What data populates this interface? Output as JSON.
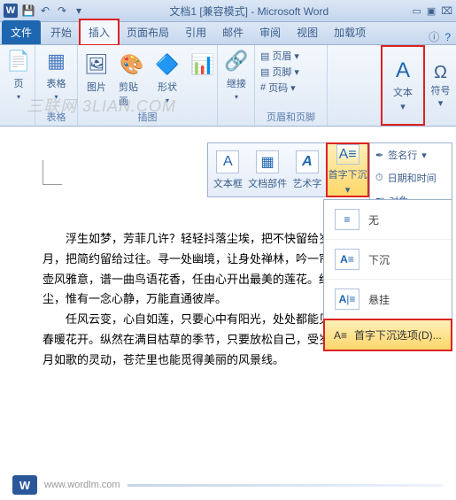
{
  "title": "文档1 [兼容模式] - Microsoft Word",
  "tabs": {
    "file": "文件",
    "home": "开始",
    "insert": "插入",
    "layout": "页面布局",
    "ref": "引用",
    "mail": "邮件",
    "review": "审阅",
    "view": "视图",
    "addin": "加载项"
  },
  "ribbon": {
    "page": "页",
    "table": "表格",
    "pic": "图片",
    "clip": "剪贴画",
    "shape": "形状",
    "chart": "继接",
    "glabels": {
      "table": "表格",
      "illus": "插图",
      "hdr": "页眉和页脚"
    },
    "header": "页眉",
    "footer": "页脚",
    "num": "页码",
    "text": "文本",
    "symbol": "符号"
  },
  "watermark": "三联网 3LIAN.COM",
  "txtdrop": {
    "a": "文本框",
    "b": "文档部件",
    "c": "艺术字",
    "d": "首字下沉"
  },
  "side": {
    "sig": "签名行",
    "dt": "日期和时间",
    "obj": "对象"
  },
  "dropcap": {
    "none": "无",
    "dropped": "下沉",
    "margin": "悬挂",
    "opt": "首字下沉选项(D)..."
  },
  "doc": {
    "p1": "浮生如梦，芳菲几许？轻轻抖落尘埃，把不快留给岁月，把简约留给过往。寻一处幽境，让身处禅林，吟一帘壶风雅意，谱一曲鸟语花香，任由心开出最美的莲花。红尘，惟有一念心静，万能直通彼岸。",
    "p2": "任风云变，心自如莲，只要心中有阳光，处处都能见春暖花开。纵然在满目枯草的季节，只要放松自己，受岁月如歌的灵动，苍茫里也能觅得美丽的风景线。"
  },
  "footer_url": "www.wordlm.com"
}
